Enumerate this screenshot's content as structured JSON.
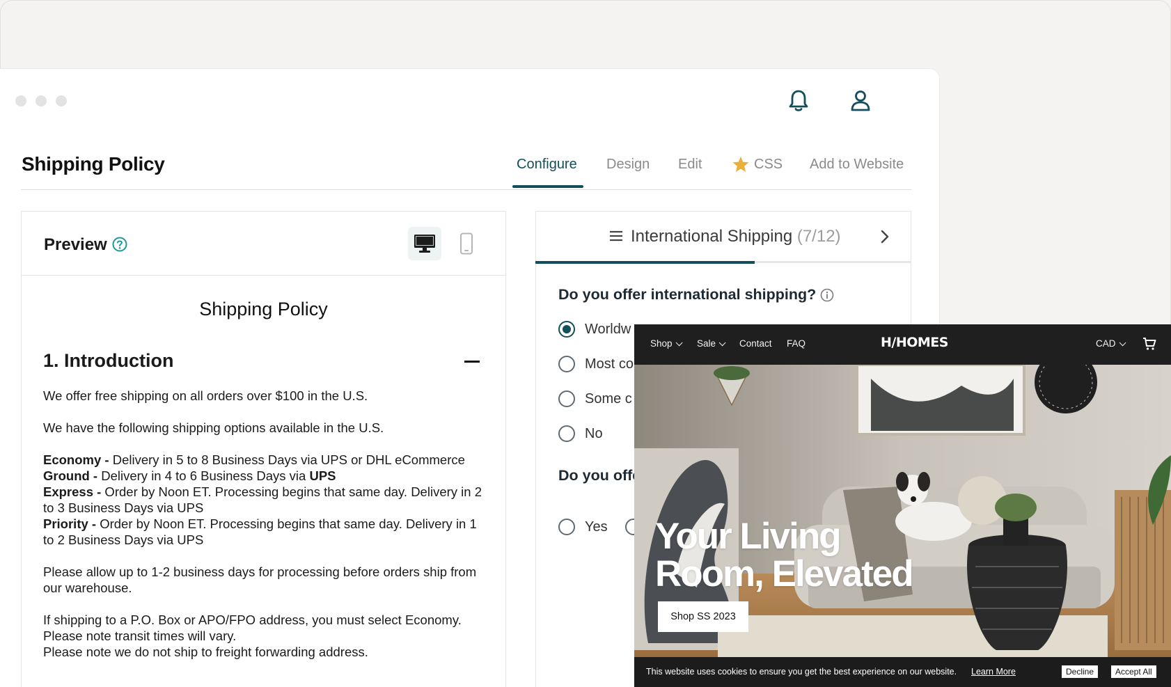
{
  "app": {
    "page_title": "Shipping Policy",
    "tabs": [
      {
        "label": "Configure",
        "active": true
      },
      {
        "label": "Design",
        "active": false
      },
      {
        "label": "Edit",
        "active": false
      },
      {
        "label": "CSS",
        "active": false,
        "icon": "star-icon"
      },
      {
        "label": "Add to Website",
        "active": false
      }
    ],
    "icons": {
      "notifications": "bell-icon",
      "account": "user-icon"
    },
    "accent_color": "#124e5b"
  },
  "preview": {
    "label": "Preview",
    "document": {
      "title": "Shipping Policy",
      "section_title": "1. Introduction",
      "p1": "We offer free shipping on all orders over $100 in the U.S.",
      "p2": "We have the following shipping options available in the U.S.",
      "economy_label": "Economy -",
      "economy_text": " Delivery in 5 to 8 Business Days via UPS or DHL eCommerce",
      "ground_label": "Ground -",
      "ground_text": " Delivery in 4 to 6 Business Days via ",
      "ground_carrier": "UPS",
      "express_label": "Express -",
      "express_text": " Order by Noon ET. Processing begins that same day. Delivery in 2 to 3 Business Days via UPS",
      "priority_label": "Priority -",
      "priority_text": " Order by Noon ET. Processing begins that same day. Delivery in 1 to 2 Business Days via UPS",
      "p3": "Please allow up to 1-2 business days for processing before orders ship from our warehouse.",
      "p4a": "If shipping to a P.O. Box or APO/FPO address, you must select Economy. Please note transit times will vary.",
      "p4b": "Please note we do not ship to freight forwarding address."
    }
  },
  "questions": {
    "section_title": "International Shipping",
    "section_progress": "(7/12)",
    "progress_fraction": 0.583,
    "q1": {
      "text": "Do you offer international shipping?",
      "options": [
        "Worldw",
        "Most co",
        "Some c",
        "No"
      ],
      "selected_index": 0
    },
    "q2": {
      "text": "Do you offe orders?",
      "options": [
        "Yes"
      ]
    }
  },
  "website": {
    "nav": {
      "shop": "Shop",
      "sale": "Sale",
      "contact": "Contact",
      "faq": "FAQ",
      "currency": "CAD"
    },
    "logo": "H/HOMES",
    "hero_line1": "Your Living",
    "hero_line2": "Room, Elevated",
    "cta": "Shop SS 2023",
    "cookie": {
      "text": "This website uses cookies to ensure you get the best experience on our website.",
      "link": "Learn More",
      "decline": "Decline",
      "accept": "Accept All"
    }
  }
}
